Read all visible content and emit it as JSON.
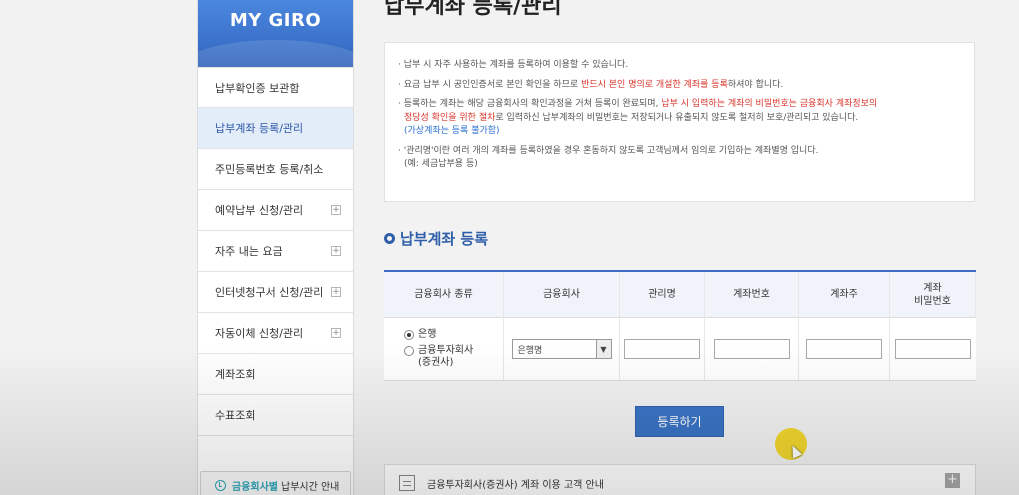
{
  "sidebar": {
    "brand": "MY GIRO",
    "items": [
      {
        "label": "납부확인증 보관함",
        "expandable": false,
        "active": false
      },
      {
        "label": "납부계좌 등록/관리",
        "expandable": false,
        "active": true
      },
      {
        "label": "주민등록번호 등록/취소",
        "expandable": false,
        "active": false
      },
      {
        "label": "예약납부 신청/관리",
        "expandable": true,
        "active": false
      },
      {
        "label": "자주 내는 요금",
        "expandable": true,
        "active": false
      },
      {
        "label": "인터넷청구서 신청/관리",
        "expandable": true,
        "active": false
      },
      {
        "label": "자동이체 신청/관리",
        "expandable": true,
        "active": false
      },
      {
        "label": "계좌조회",
        "expandable": false,
        "active": false
      },
      {
        "label": "수표조회",
        "expandable": false,
        "active": false
      }
    ],
    "expand_symbol": "+",
    "hours_button": {
      "highlight": "금융회사별",
      "label": "납부시간 안내"
    }
  },
  "main": {
    "title": "납부계좌 등록/관리",
    "notice": {
      "line1": "· 납부 시 자주 사용하는 계좌를 등록하여 이용할 수 있습니다.",
      "line2_a": "· 요금 납부 시 공인인증서로 본인 확인을 하므로 ",
      "line2_b": "반드시 본인 명의로 개설한 계좌를 등록",
      "line2_c": "하셔야 합니다.",
      "line3_a": "· 등록하는 계좌는 해당 금융회사의 확인과정을 거쳐 등록이 완료되며, ",
      "line3_b": "납부 시 입력하는 계좌의 비밀번호는 금융회사 계좌정보의",
      "line4_b": "정당성 확인을 위한 절차",
      "line4_c": "로 입력하신 납부계좌의 비밀번호는 저장되거나 유출되지 않도록 철저히 보호/관리되고 있습니다.",
      "line5": "(가상계좌는 등록 불가함)",
      "line6": "· '관리명'이란 여러 개의 계좌를 등록하였을 경우 혼동하지 않도록 고객님께서 임의로 기입하는 계좌별명 입니다.",
      "line7": "(예: 세금납부용 등)"
    },
    "section_title": "납부계좌 등록",
    "table": {
      "headers": [
        "금융회사 종류",
        "금융회사",
        "관리명",
        "계좌번호",
        "계좌주",
        "계좌\n비밀번호"
      ],
      "institution_types": [
        {
          "label": "은행",
          "checked": true
        },
        {
          "label": "금융투자회사\n(증권사)",
          "checked": false
        }
      ],
      "select_value": "은행명",
      "select_arrow": "▼"
    },
    "submit_label": "등록하기",
    "accordion_label": "금융투자회사(증권사) 계좌 이용 고객 안내",
    "accordion_expand": "+"
  },
  "colors": {
    "brand_blue": "#3c73cc",
    "accent_teal": "#2ea6b8",
    "notice_red": "#d9352b",
    "notice_blue": "#2b6fd1",
    "cursor_highlight": "#f1d318"
  }
}
